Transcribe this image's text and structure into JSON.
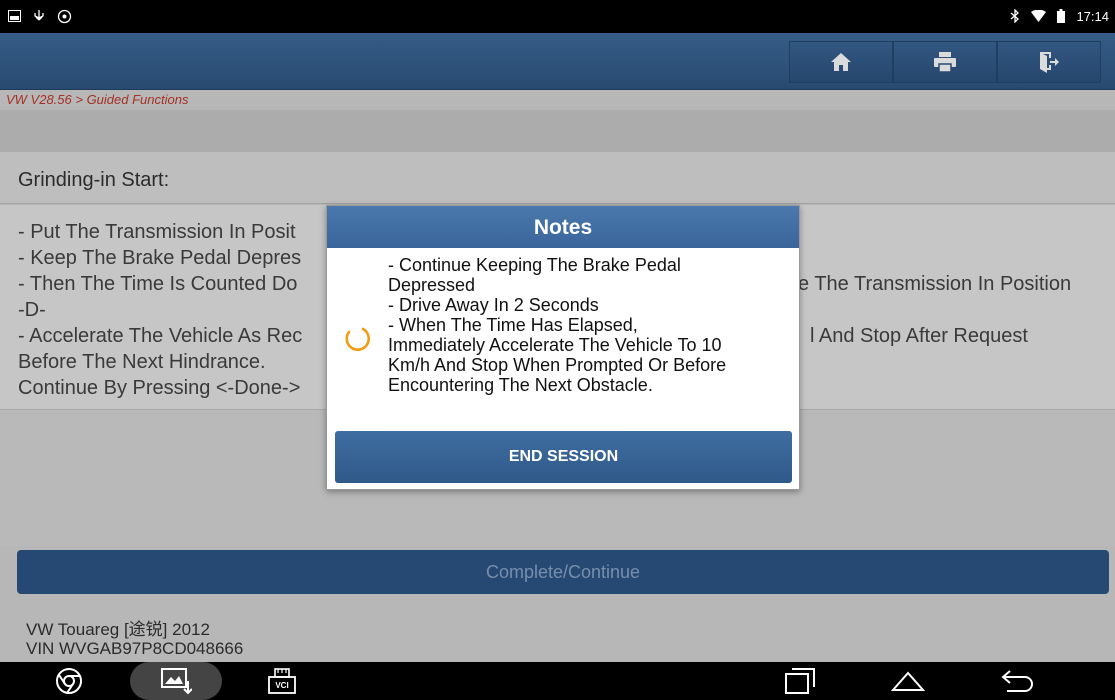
{
  "status_bar": {
    "left_icons": [
      "gallery-icon",
      "usb-icon",
      "settings-icon"
    ],
    "right_icons": [
      "bluetooth-icon",
      "wifi-icon",
      "battery-icon"
    ],
    "time": "17:14"
  },
  "toolbar": {
    "buttons": [
      "home-icon",
      "print-icon",
      "exit-icon"
    ]
  },
  "breadcrumb": "VW V28.56 > Guided Functions",
  "section_title": "Grinding-in Start:",
  "instructions": [
    "- Put The Transmission In Posit",
    "- Keep The Brake Pedal Depres",
    "- Then The Time Is Counted Do",
    "e The Transmission In Position",
    "-D-",
    "- Accelerate The Vehicle As Rec",
    "l And Stop After Request",
    "Before The Next Hindrance.",
    "Continue By Pressing <-Done->"
  ],
  "continue_button": "Complete/Continue",
  "vehicle": {
    "model": "VW Touareg [途锐] 2012",
    "vin": "VIN WVGAB97P8CD048666"
  },
  "dialog": {
    "title": "Notes",
    "lines": [
      "- Continue Keeping The Brake Pedal",
      "Depressed",
      "- Drive Away In 2 Seconds",
      "- When The Time Has Elapsed,",
      "Immediately Accelerate The Vehicle To 10",
      "Km/h And Stop When Prompted Or Before",
      "Encountering The Next Obstacle."
    ],
    "button": "END SESSION"
  },
  "nav_bar": {
    "left_icons": [
      "chrome-icon",
      "screenshot-icon",
      "vci-icon"
    ],
    "vci_label": "VCI",
    "right_icons": [
      "recent-apps-icon",
      "home-nav-icon",
      "back-icon"
    ]
  },
  "colors": {
    "header_blue": "#2f5784",
    "breadcrumb_red": "#c0392b",
    "spinner_orange": "#f39c12"
  }
}
